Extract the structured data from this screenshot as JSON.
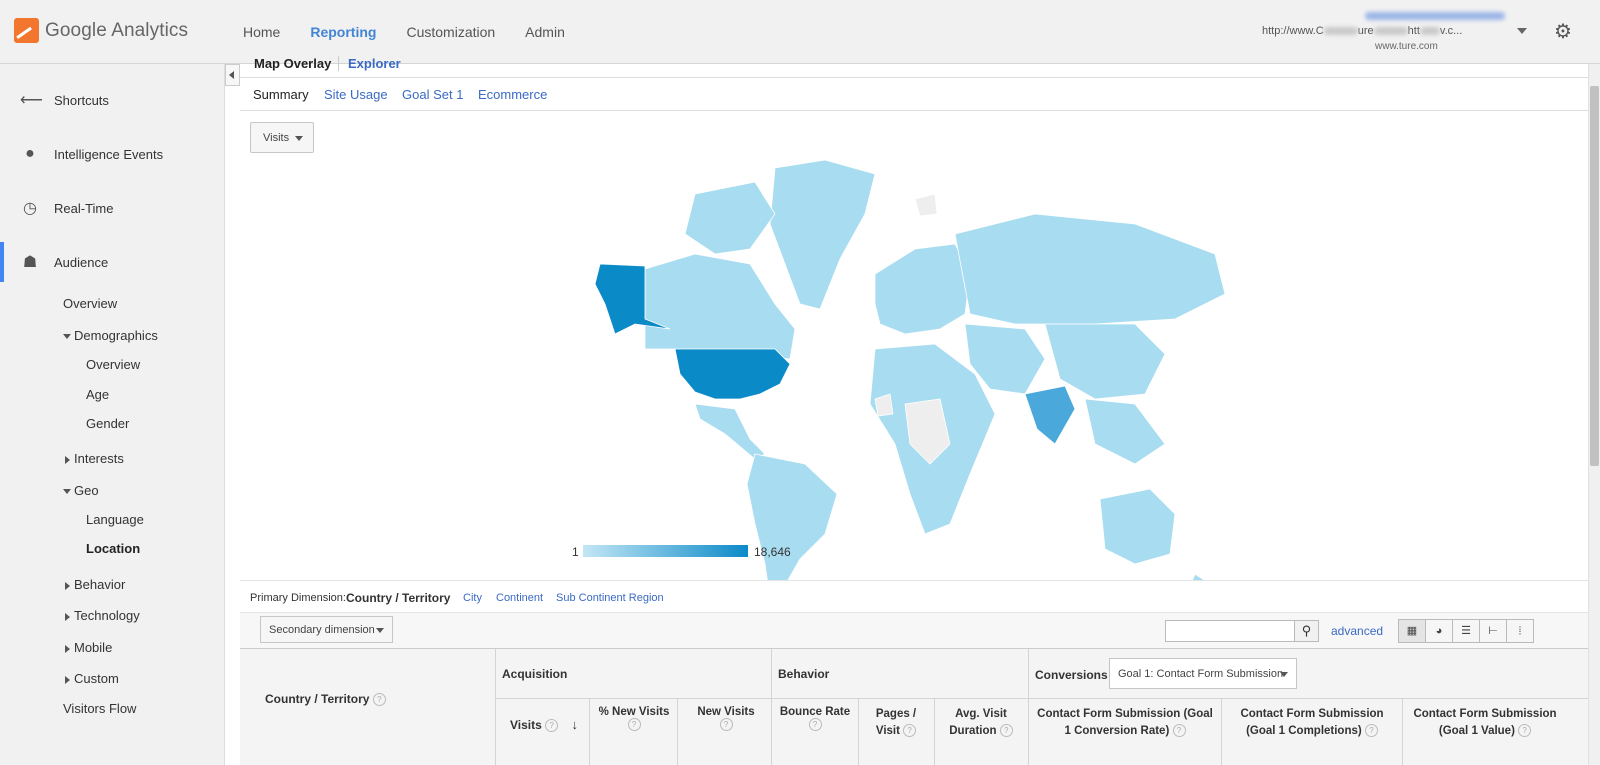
{
  "app": {
    "logo_text": "Google Analytics"
  },
  "topnav": [
    {
      "label": "Home"
    },
    {
      "label": "Reporting"
    },
    {
      "label": "Customization"
    },
    {
      "label": "Admin"
    }
  ],
  "account": {
    "url": "http://www.C",
    "url_tail": "v.c...",
    "sub_prefix": "www.",
    "sub_suffix": ".com"
  },
  "sidebar": {
    "main": [
      {
        "label": "Shortcuts",
        "icon": "shortcuts-icon"
      },
      {
        "label": "Intelligence Events",
        "icon": "lightbulb-icon"
      },
      {
        "label": "Real-Time",
        "icon": "clock-icon"
      },
      {
        "label": "Audience",
        "icon": "people-icon"
      }
    ],
    "sub": {
      "overview": "Overview",
      "demographics": "Demographics",
      "demo_overview": "Overview",
      "age": "Age",
      "gender": "Gender",
      "interests": "Interests",
      "geo": "Geo",
      "language": "Language",
      "location": "Location",
      "behavior": "Behavior",
      "technology": "Technology",
      "mobile": "Mobile",
      "custom": "Custom",
      "visitors_flow": "Visitors Flow"
    }
  },
  "view_tabs": {
    "active": "Map Overlay",
    "other": "Explorer"
  },
  "tabs": {
    "summary": "Summary",
    "site_usage": "Site Usage",
    "goal_set": "Goal Set 1",
    "ecommerce": "Ecommerce"
  },
  "metric_select": "Visits",
  "map_legend": {
    "min": "1",
    "max": "18,646"
  },
  "primary_dimension": {
    "label": "Primary Dimension:",
    "current": "Country / Territory",
    "city": "City",
    "continent": "Continent",
    "sub_continent": "Sub Continent Region"
  },
  "controls": {
    "secondary_dimension": "Secondary dimension",
    "advanced": "advanced"
  },
  "table": {
    "country_header": "Country / Territory",
    "acquisition": "Acquisition",
    "behavior": "Behavior",
    "conversions": "Conversions",
    "goal_select": "Goal 1: Contact Form Submission",
    "cols": {
      "visits": "Visits",
      "pct_new": "% New Visits",
      "new_visits": "New Visits",
      "bounce": "Bounce Rate",
      "pages_l1": "Pages /",
      "pages_l2": "Visit",
      "avg_l1": "Avg. Visit",
      "avg_l2": "Duration",
      "cr_l1": "Contact Form Submission (Goal",
      "cr_l2": "1 Conversion Rate)",
      "comp_l1": "Contact Form Submission",
      "comp_l2": "(Goal 1 Completions)",
      "val_l1": "Contact Form Submission",
      "val_l2": "(Goal 1 Value)"
    }
  },
  "colors": {
    "accent": "#4285f4",
    "link": "#3b6ac4",
    "map_low": "#a8dcf0",
    "map_high": "#0b8ac8"
  }
}
